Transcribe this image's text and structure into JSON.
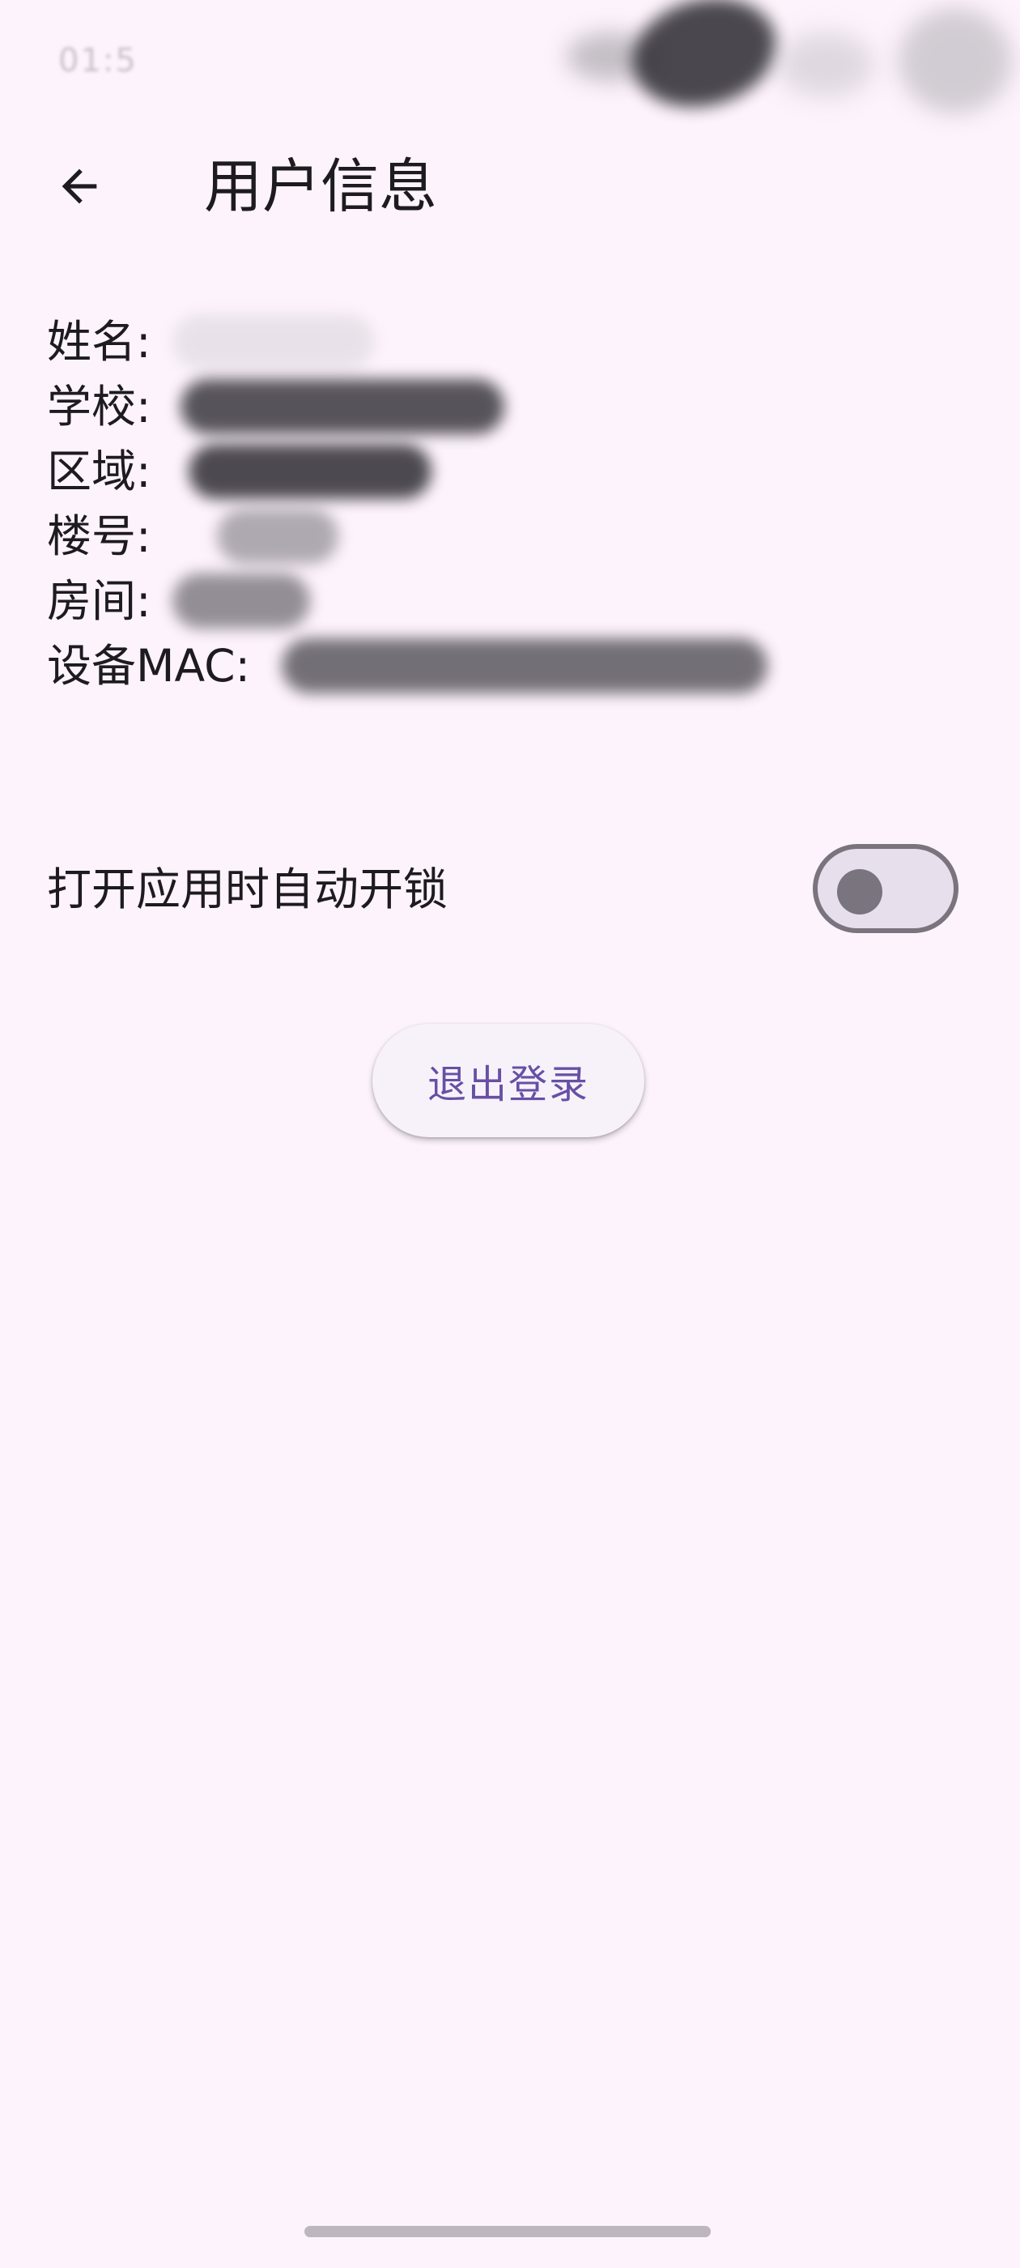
{
  "status_bar": {
    "time": "01:5"
  },
  "header": {
    "title": "用户信息",
    "back_icon": "arrow-left-icon"
  },
  "user_info": {
    "fields": [
      {
        "label": "姓名:"
      },
      {
        "label": "学校:"
      },
      {
        "label": "区域:"
      },
      {
        "label": "楼号:"
      },
      {
        "label": "房间:"
      },
      {
        "label": "设备MAC:"
      }
    ]
  },
  "settings": {
    "auto_unlock": {
      "label": "打开应用时自动开锁",
      "enabled": false
    }
  },
  "actions": {
    "logout_label": "退出登录"
  },
  "colors": {
    "background": "#fdf3fc",
    "primary": "#6750a4",
    "text": "#1d1b20",
    "outline": "#79747e"
  }
}
